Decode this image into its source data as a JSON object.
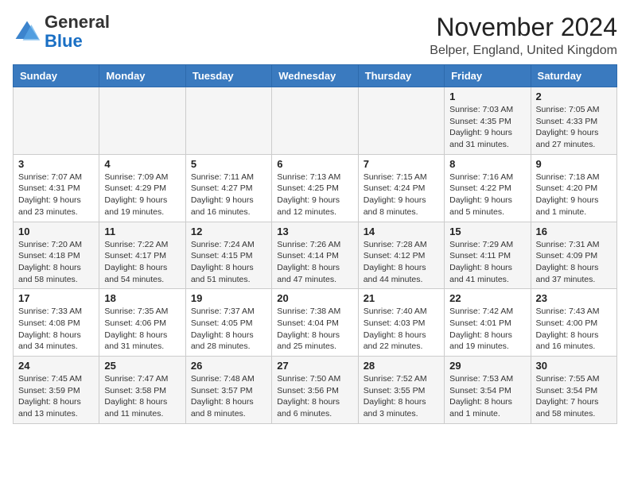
{
  "header": {
    "logo_general": "General",
    "logo_blue": "Blue",
    "month_title": "November 2024",
    "location": "Belper, England, United Kingdom"
  },
  "weekdays": [
    "Sunday",
    "Monday",
    "Tuesday",
    "Wednesday",
    "Thursday",
    "Friday",
    "Saturday"
  ],
  "weeks": [
    [
      {
        "day": "",
        "info": ""
      },
      {
        "day": "",
        "info": ""
      },
      {
        "day": "",
        "info": ""
      },
      {
        "day": "",
        "info": ""
      },
      {
        "day": "",
        "info": ""
      },
      {
        "day": "1",
        "info": "Sunrise: 7:03 AM\nSunset: 4:35 PM\nDaylight: 9 hours and 31 minutes."
      },
      {
        "day": "2",
        "info": "Sunrise: 7:05 AM\nSunset: 4:33 PM\nDaylight: 9 hours and 27 minutes."
      }
    ],
    [
      {
        "day": "3",
        "info": "Sunrise: 7:07 AM\nSunset: 4:31 PM\nDaylight: 9 hours and 23 minutes."
      },
      {
        "day": "4",
        "info": "Sunrise: 7:09 AM\nSunset: 4:29 PM\nDaylight: 9 hours and 19 minutes."
      },
      {
        "day": "5",
        "info": "Sunrise: 7:11 AM\nSunset: 4:27 PM\nDaylight: 9 hours and 16 minutes."
      },
      {
        "day": "6",
        "info": "Sunrise: 7:13 AM\nSunset: 4:25 PM\nDaylight: 9 hours and 12 minutes."
      },
      {
        "day": "7",
        "info": "Sunrise: 7:15 AM\nSunset: 4:24 PM\nDaylight: 9 hours and 8 minutes."
      },
      {
        "day": "8",
        "info": "Sunrise: 7:16 AM\nSunset: 4:22 PM\nDaylight: 9 hours and 5 minutes."
      },
      {
        "day": "9",
        "info": "Sunrise: 7:18 AM\nSunset: 4:20 PM\nDaylight: 9 hours and 1 minute."
      }
    ],
    [
      {
        "day": "10",
        "info": "Sunrise: 7:20 AM\nSunset: 4:18 PM\nDaylight: 8 hours and 58 minutes."
      },
      {
        "day": "11",
        "info": "Sunrise: 7:22 AM\nSunset: 4:17 PM\nDaylight: 8 hours and 54 minutes."
      },
      {
        "day": "12",
        "info": "Sunrise: 7:24 AM\nSunset: 4:15 PM\nDaylight: 8 hours and 51 minutes."
      },
      {
        "day": "13",
        "info": "Sunrise: 7:26 AM\nSunset: 4:14 PM\nDaylight: 8 hours and 47 minutes."
      },
      {
        "day": "14",
        "info": "Sunrise: 7:28 AM\nSunset: 4:12 PM\nDaylight: 8 hours and 44 minutes."
      },
      {
        "day": "15",
        "info": "Sunrise: 7:29 AM\nSunset: 4:11 PM\nDaylight: 8 hours and 41 minutes."
      },
      {
        "day": "16",
        "info": "Sunrise: 7:31 AM\nSunset: 4:09 PM\nDaylight: 8 hours and 37 minutes."
      }
    ],
    [
      {
        "day": "17",
        "info": "Sunrise: 7:33 AM\nSunset: 4:08 PM\nDaylight: 8 hours and 34 minutes."
      },
      {
        "day": "18",
        "info": "Sunrise: 7:35 AM\nSunset: 4:06 PM\nDaylight: 8 hours and 31 minutes."
      },
      {
        "day": "19",
        "info": "Sunrise: 7:37 AM\nSunset: 4:05 PM\nDaylight: 8 hours and 28 minutes."
      },
      {
        "day": "20",
        "info": "Sunrise: 7:38 AM\nSunset: 4:04 PM\nDaylight: 8 hours and 25 minutes."
      },
      {
        "day": "21",
        "info": "Sunrise: 7:40 AM\nSunset: 4:03 PM\nDaylight: 8 hours and 22 minutes."
      },
      {
        "day": "22",
        "info": "Sunrise: 7:42 AM\nSunset: 4:01 PM\nDaylight: 8 hours and 19 minutes."
      },
      {
        "day": "23",
        "info": "Sunrise: 7:43 AM\nSunset: 4:00 PM\nDaylight: 8 hours and 16 minutes."
      }
    ],
    [
      {
        "day": "24",
        "info": "Sunrise: 7:45 AM\nSunset: 3:59 PM\nDaylight: 8 hours and 13 minutes."
      },
      {
        "day": "25",
        "info": "Sunrise: 7:47 AM\nSunset: 3:58 PM\nDaylight: 8 hours and 11 minutes."
      },
      {
        "day": "26",
        "info": "Sunrise: 7:48 AM\nSunset: 3:57 PM\nDaylight: 8 hours and 8 minutes."
      },
      {
        "day": "27",
        "info": "Sunrise: 7:50 AM\nSunset: 3:56 PM\nDaylight: 8 hours and 6 minutes."
      },
      {
        "day": "28",
        "info": "Sunrise: 7:52 AM\nSunset: 3:55 PM\nDaylight: 8 hours and 3 minutes."
      },
      {
        "day": "29",
        "info": "Sunrise: 7:53 AM\nSunset: 3:54 PM\nDaylight: 8 hours and 1 minute."
      },
      {
        "day": "30",
        "info": "Sunrise: 7:55 AM\nSunset: 3:54 PM\nDaylight: 7 hours and 58 minutes."
      }
    ]
  ]
}
